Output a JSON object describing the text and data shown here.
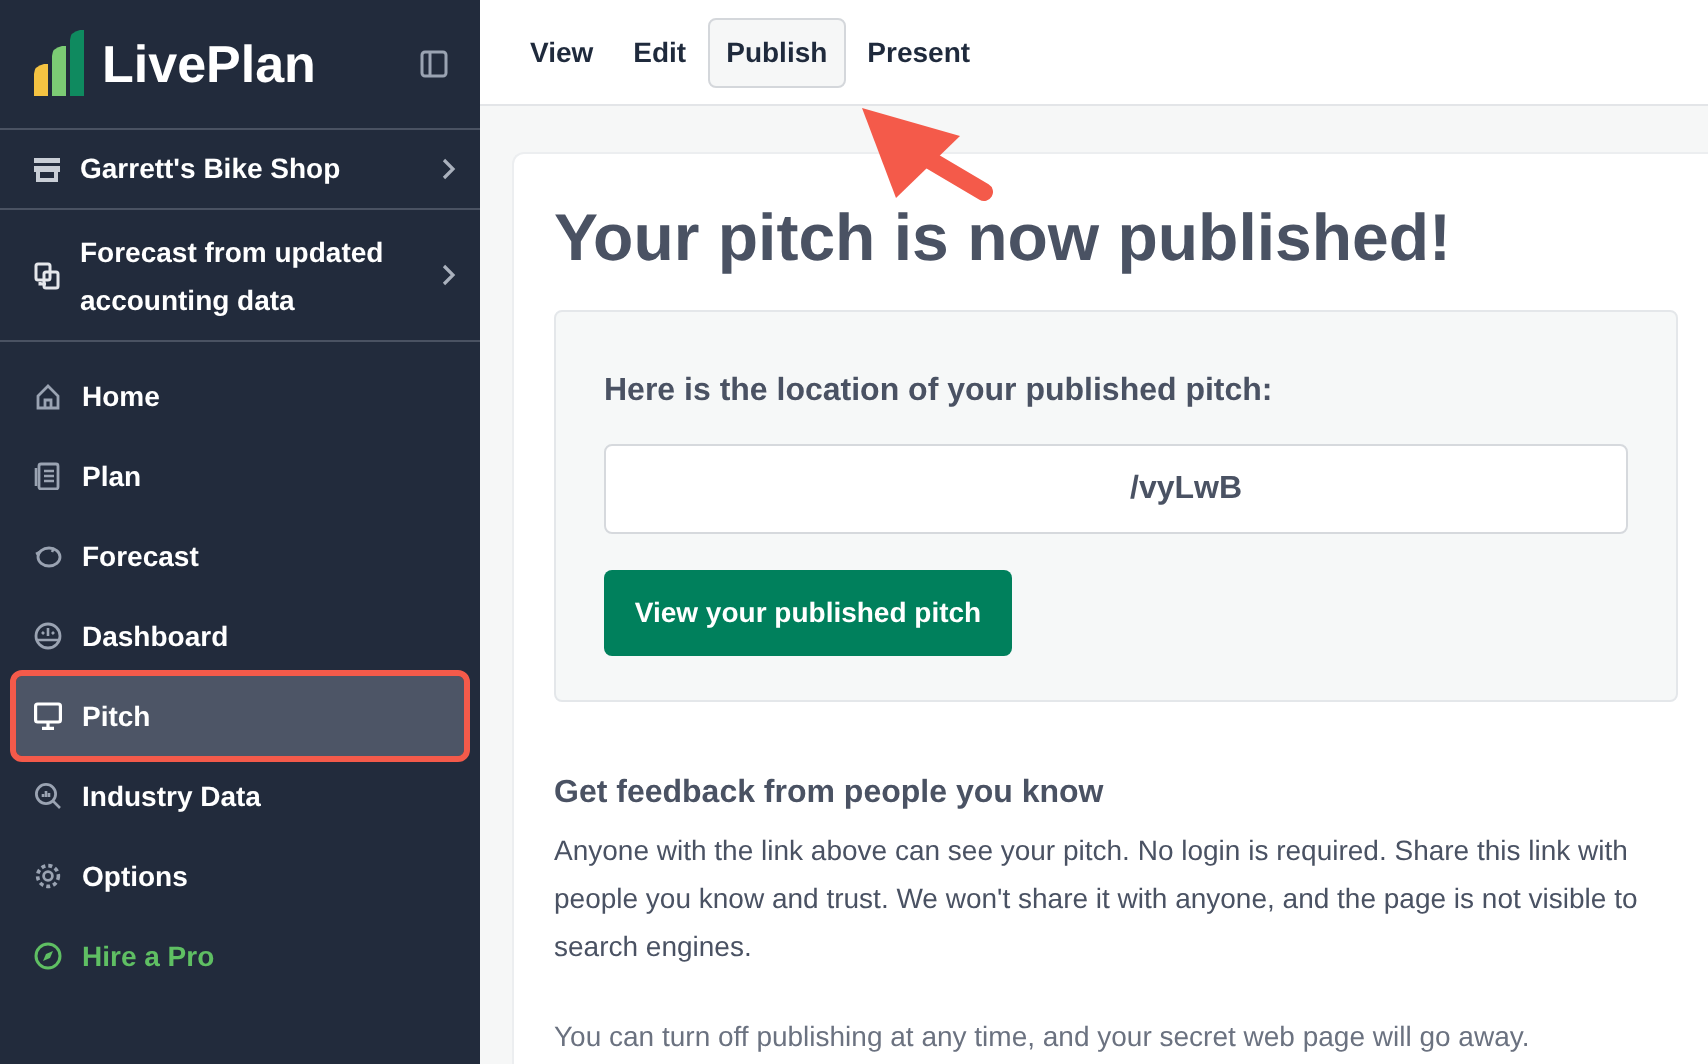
{
  "sidebar": {
    "logo": "LivePlan",
    "business": "Garrett's Bike Shop",
    "forecast_source": "Forecast from updated accounting data",
    "items": [
      {
        "label": "Home",
        "selected": false,
        "kind": "nav"
      },
      {
        "label": "Plan",
        "selected": false,
        "kind": "nav"
      },
      {
        "label": "Forecast",
        "selected": false,
        "kind": "nav"
      },
      {
        "label": "Dashboard",
        "selected": false,
        "kind": "nav"
      },
      {
        "label": "Pitch",
        "selected": true,
        "kind": "nav"
      },
      {
        "label": "Industry Data",
        "selected": false,
        "kind": "nav"
      },
      {
        "label": "Options",
        "selected": false,
        "kind": "nav"
      },
      {
        "label": "Hire a Pro",
        "selected": false,
        "kind": "promo"
      }
    ]
  },
  "tabs": [
    {
      "label": "View",
      "selected": false
    },
    {
      "label": "Edit",
      "selected": false
    },
    {
      "label": "Publish",
      "selected": true
    },
    {
      "label": "Present",
      "selected": false
    }
  ],
  "main": {
    "title": "Your pitch is now published!",
    "location_label": "Here is the location of your published pitch:",
    "location_value": "/vyLwB",
    "view_button": "View your published pitch",
    "feedback_heading": "Get feedback from people you know",
    "feedback_text": "Anyone with the link above can see your pitch. No login is required. Share this link with people you know and trust. We won't share it with anyone, and the page is not visible to search engines.",
    "note": "You can turn off publishing at any time, and your secret web page will go away."
  }
}
